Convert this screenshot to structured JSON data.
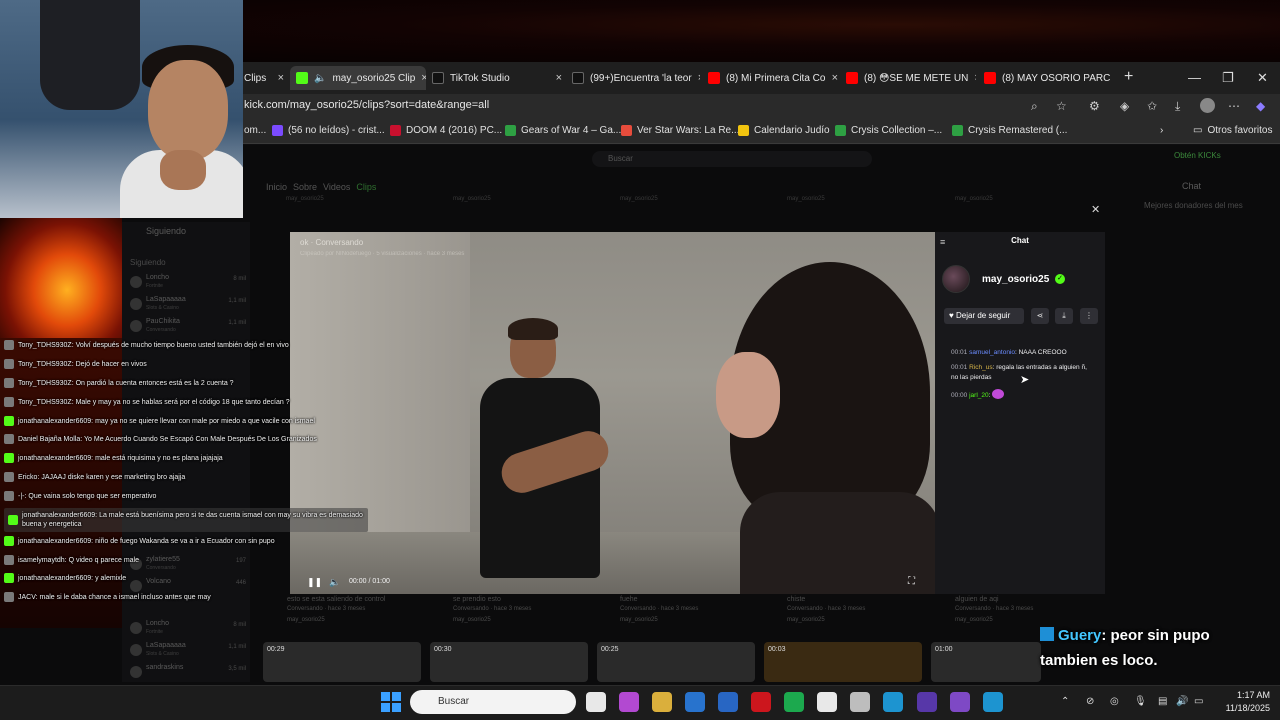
{
  "browser": {
    "tabs": [
      {
        "label": "Clips",
        "color": "#53fc18"
      },
      {
        "label": "may_osorio25 Clip",
        "color": "#53fc18"
      },
      {
        "label": "TikTok Studio",
        "color": "#111111"
      },
      {
        "label": "(99+)Encuentra 'la teor",
        "color": "#111111"
      },
      {
        "label": "(8) Mi Primera Cita Co",
        "color": "#ff0000"
      },
      {
        "label": "(8) 😳SE ME METE UN",
        "color": "#ff0000"
      },
      {
        "label": "(8) MAY OSORIO PARC",
        "color": "#ff0000"
      }
    ],
    "url": "kick.com/may_osorio25/clips?sort=date&range=all",
    "bookmarks": [
      {
        "label": "(56 no leídos) - crist...",
        "color": "#7b4bff"
      },
      {
        "label": "DOOM 4 (2016) PC...",
        "color": "#c8102e"
      },
      {
        "label": "Gears of War 4 – Ga...",
        "color": "#2ea043"
      },
      {
        "label": "Ver Star Wars: La Re...",
        "color": "#e74c3c"
      },
      {
        "label": "Calendario Judío",
        "color": "#f1c40f"
      },
      {
        "label": "Crysis Collection –...",
        "color": "#2ea043"
      },
      {
        "label": "Crysis Remastered (...",
        "color": "#2ea043"
      }
    ],
    "bookmarks_folder": "Otros favoritos",
    "bookmarks_partial": "om..."
  },
  "page": {
    "search_placeholder": "Buscar",
    "get_kicks": "Obtén KICKs",
    "nav": [
      "Inicio",
      "Sobre",
      "Videos",
      "Clips"
    ],
    "chat_label": "Chat",
    "donors_label": "Mejores donadores del mes",
    "sidebar": {
      "header": "Siguiendo",
      "section": "Siguiendo",
      "items": [
        {
          "name": "Loncho",
          "sub": "Fortnite",
          "count": "8 mil"
        },
        {
          "name": "LaSapaaaaa",
          "sub": "Slots & Casino",
          "count": "1,1 mil"
        },
        {
          "name": "PauChikita",
          "sub": "Conversando",
          "count": "1,1 mil"
        }
      ],
      "items_bottom": [
        {
          "name": "zylatiere55",
          "sub": "Conversando",
          "count": "197"
        },
        {
          "name": "Volcano",
          "sub": "",
          "count": "446"
        },
        {
          "name": "Loncho",
          "sub": "Fortnite",
          "count": "8 mil"
        },
        {
          "name": "LaSapaaaaa",
          "sub": "Slots & Casino",
          "count": "1,1 mil"
        },
        {
          "name": "sandraskins",
          "sub": "",
          "count": "3,5 mil"
        }
      ]
    },
    "grid_top_labels": [
      "may_osorio25",
      "may_osorio25",
      "may_osorio25",
      "may_osorio25",
      "may_osorio25"
    ],
    "grid_bottom": [
      {
        "title": "esto se esta saliendo de control",
        "sub": "Conversando · hace 3 meses",
        "user": "may_osorio25"
      },
      {
        "title": "se prendio esto",
        "sub": "Conversando · hace 3 meses",
        "user": "may_osorio25"
      },
      {
        "title": "fuehe",
        "sub": "Conversando · hace 3 meses",
        "user": "may_osorio25"
      },
      {
        "title": "chiste",
        "sub": "Conversando · hace 3 meses",
        "user": "may_osorio25"
      },
      {
        "title": "alguien de aqi",
        "sub": "Conversando · hace 3 meses",
        "user": "may_osorio25"
      }
    ],
    "thumb_durations": [
      "00:29",
      "00:30",
      "00:25",
      "00:03",
      "01:00"
    ]
  },
  "video": {
    "title": "ok · Conversando",
    "sub": "Clipeado por NINodefuego · 5 visualizaciones · hace 3 meses",
    "time": "00:00 / 01:00"
  },
  "chat": {
    "header": "Chat",
    "channel": "may_osorio25",
    "unfollow": "Dejar de seguir",
    "messages": [
      {
        "time": "00:01",
        "user": "samuel_antonio",
        "text": ": NAAA CREOOO",
        "ucls": "u1"
      },
      {
        "time": "00:01",
        "user": "Rich_us",
        "text": ": regala las entradas a alguien ñ, no las pierdas",
        "ucls": "u2"
      },
      {
        "time": "00:00",
        "user": "jarl_20",
        "text": ":",
        "ucls": "u3"
      }
    ]
  },
  "overlay_chat": [
    {
      "text": "Tony_TDHS930Z: Volví después de mucho tiempo bueno usted también dejó el en vivo",
      "badge": "g"
    },
    {
      "text": "Tony_TDHS930Z: Dejó de hacer en vivos",
      "badge": "g"
    },
    {
      "text": "Tony_TDHS930Z: On pardió la cuenta entonces está es la 2 cuenta ?",
      "badge": "g"
    },
    {
      "text": "Tony_TDHS930Z: Male y may ya no se hablas será por el código 18 que tanto decían ?",
      "badge": "g"
    },
    {
      "text": "jonathanalexander6609: may ya no se quiere llevar con male por miedo a que vacile con ismael",
      "badge": ""
    },
    {
      "text": "Daniel Bajaña Molla: Yo Me Acuerdo Cuando Se Escapó Con Male Después De Los Granizados",
      "badge": "g"
    },
    {
      "text": "jonathanalexander6609: male está riquisima y no es plana jajajaja",
      "badge": ""
    },
    {
      "text": "Ericko: JAJAAJ diske karen y ese marketing bro ajajja",
      "badge": "g"
    },
    {
      "text": "-|-: Que vaina solo tengo que ser emperativo",
      "badge": "g"
    },
    {
      "text": "jonathanalexander6609: La male está buenísima pero si te das cuenta ismael con may su vibra es demasiado buena y energetica",
      "badge": ""
    },
    {
      "text": "jonathanalexander6609: niño de fuego Wakanda se va a ir a Ecuador con sin pupo",
      "badge": ""
    },
    {
      "text": "isamelymaytdh: Q video q parece male",
      "badge": "g"
    },
    {
      "text": "jonathanalexander6609: y alemixle",
      "badge": ""
    },
    {
      "text": "JACV: male si le daba chance a ismael incluso antes que may",
      "badge": "g"
    }
  ],
  "alert": {
    "user": "Guery",
    "text": ": peor sin pupo tambien es loco."
  },
  "taskbar": {
    "search": "Buscar",
    "time": "1:17 AM",
    "date": "11/18/2025",
    "apps": [
      "#ffffff",
      "#c34fe6",
      "#f0c040",
      "#2a7de1",
      "#2a6fd6",
      "#e0161e",
      "#1db954",
      "#ffffff",
      "#cfcfcf",
      "#1ea2e4",
      "#5e3bb8",
      "#8a4fd8",
      "#1ea2e4"
    ]
  }
}
